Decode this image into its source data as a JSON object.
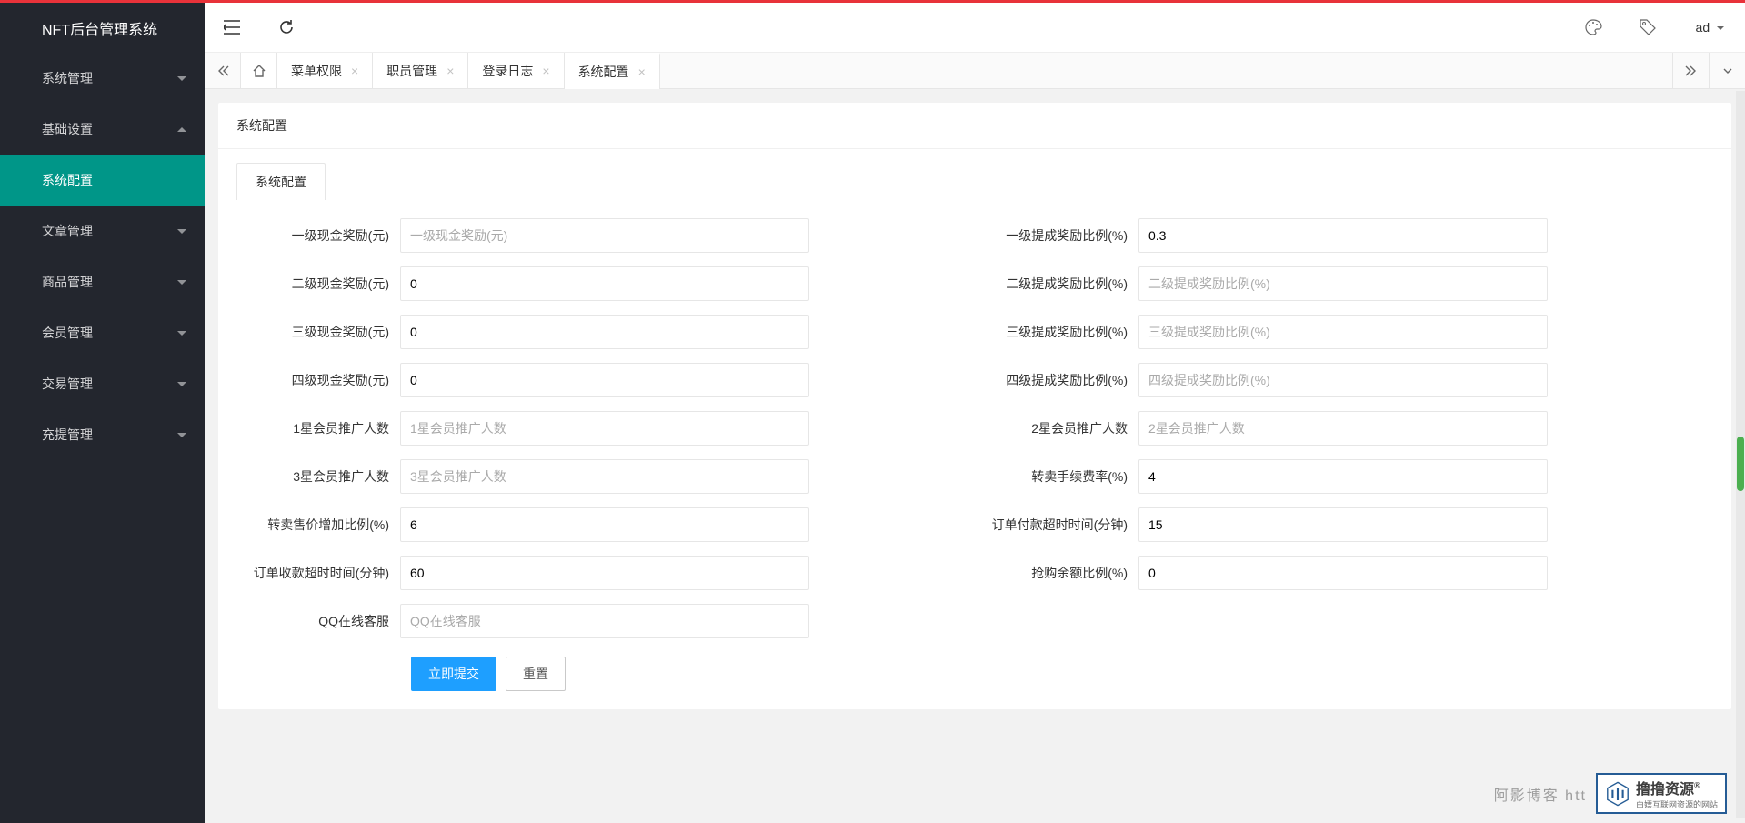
{
  "app": {
    "title": "NFT后台管理系统"
  },
  "sidebar": {
    "items": [
      {
        "label": "系统管理",
        "expanded": false
      },
      {
        "label": "基础设置",
        "expanded": true
      },
      {
        "label": "系统配置",
        "sub": true,
        "active": true
      },
      {
        "label": "文章管理",
        "expanded": false
      },
      {
        "label": "商品管理",
        "expanded": false
      },
      {
        "label": "会员管理",
        "expanded": false
      },
      {
        "label": "交易管理",
        "expanded": false
      },
      {
        "label": "充提管理",
        "expanded": false
      }
    ]
  },
  "topbar": {
    "user": "ad"
  },
  "tabs": [
    {
      "label": "菜单权限"
    },
    {
      "label": "职员管理"
    },
    {
      "label": "登录日志"
    },
    {
      "label": "系统配置",
      "active": true
    }
  ],
  "page": {
    "title": "系统配置",
    "inner_tab": "系统配置"
  },
  "form": {
    "rows": [
      {
        "left": {
          "label": "一级现金奖励(元)",
          "value": "",
          "placeholder": "一级现金奖励(元)"
        },
        "right": {
          "label": "一级提成奖励比例(%)",
          "value": "0.3",
          "placeholder": ""
        }
      },
      {
        "left": {
          "label": "二级现金奖励(元)",
          "value": "0",
          "placeholder": ""
        },
        "right": {
          "label": "二级提成奖励比例(%)",
          "value": "",
          "placeholder": "二级提成奖励比例(%)"
        }
      },
      {
        "left": {
          "label": "三级现金奖励(元)",
          "value": "0",
          "placeholder": ""
        },
        "right": {
          "label": "三级提成奖励比例(%)",
          "value": "",
          "placeholder": "三级提成奖励比例(%)"
        }
      },
      {
        "left": {
          "label": "四级现金奖励(元)",
          "value": "0",
          "placeholder": ""
        },
        "right": {
          "label": "四级提成奖励比例(%)",
          "value": "",
          "placeholder": "四级提成奖励比例(%)"
        }
      },
      {
        "left": {
          "label": "1星会员推广人数",
          "value": "",
          "placeholder": "1星会员推广人数"
        },
        "right": {
          "label": "2星会员推广人数",
          "value": "",
          "placeholder": "2星会员推广人数"
        }
      },
      {
        "left": {
          "label": "3星会员推广人数",
          "value": "",
          "placeholder": "3星会员推广人数"
        },
        "right": {
          "label": "转卖手续费率(%)",
          "value": "4",
          "placeholder": ""
        }
      },
      {
        "left": {
          "label": "转卖售价增加比例(%)",
          "value": "6",
          "placeholder": ""
        },
        "right": {
          "label": "订单付款超时时间(分钟)",
          "value": "15",
          "placeholder": ""
        }
      },
      {
        "left": {
          "label": "订单收款超时时间(分钟)",
          "value": "60",
          "placeholder": ""
        },
        "right": {
          "label": "抢购余额比例(%)",
          "value": "0",
          "placeholder": ""
        }
      },
      {
        "left": {
          "label": "QQ在线客服",
          "value": "",
          "placeholder": "QQ在线客服"
        }
      }
    ],
    "submit": "立即提交",
    "reset": "重置"
  },
  "watermark": {
    "text1": "阿影博客  htt",
    "brand": "撸撸资源",
    "sub": "白嫖互联网资源的网站"
  }
}
